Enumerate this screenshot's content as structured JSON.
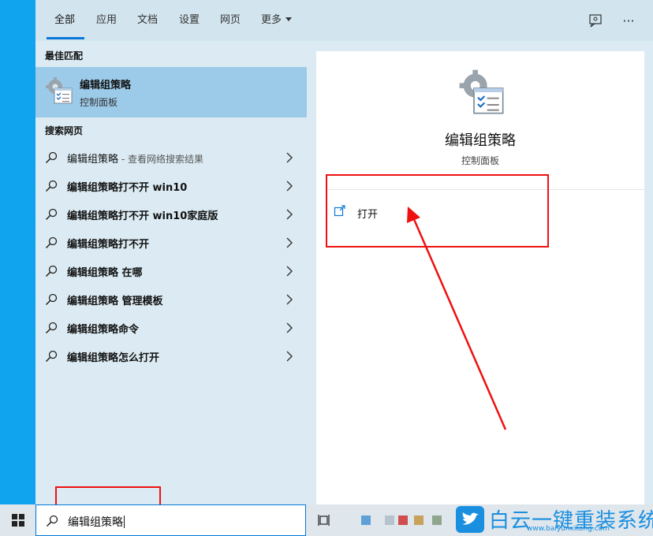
{
  "tabs": [
    {
      "label": "全部"
    },
    {
      "label": "应用"
    },
    {
      "label": "文档"
    },
    {
      "label": "设置"
    },
    {
      "label": "网页"
    },
    {
      "label": "更多"
    }
  ],
  "top_icons": {
    "feedback": "feedback-icon",
    "more": "···"
  },
  "best_match": {
    "heading": "最佳匹配",
    "name": "编辑组策略",
    "subtitle": "控制面板",
    "icon": "group-policy-icon"
  },
  "web_search": {
    "heading": "搜索网页",
    "items": [
      {
        "text": "编辑组策略",
        "hint": " - 查看网络搜索结果"
      },
      {
        "text": "编辑组策略打不开 win10",
        "hint": ""
      },
      {
        "text": "编辑组策略打不开 win10家庭版",
        "hint": ""
      },
      {
        "text": "编辑组策略打不开",
        "hint": ""
      },
      {
        "text": "编辑组策略 在哪",
        "hint": ""
      },
      {
        "text": "编辑组策略 管理模板",
        "hint": ""
      },
      {
        "text": "编辑组策略命令",
        "hint": ""
      },
      {
        "text": "编辑组策略怎么打开",
        "hint": ""
      }
    ]
  },
  "preview": {
    "title": "编辑组策略",
    "subtitle": "控制面板",
    "action_open": "打开"
  },
  "search": {
    "value": "编辑组策略"
  },
  "watermark": {
    "text": "白云一键重装系统",
    "url": "www.baiyunxitong.com"
  },
  "colors": {
    "accent": "#0078d7",
    "annotation": "#ee1111",
    "selected": "#9ccbea"
  }
}
